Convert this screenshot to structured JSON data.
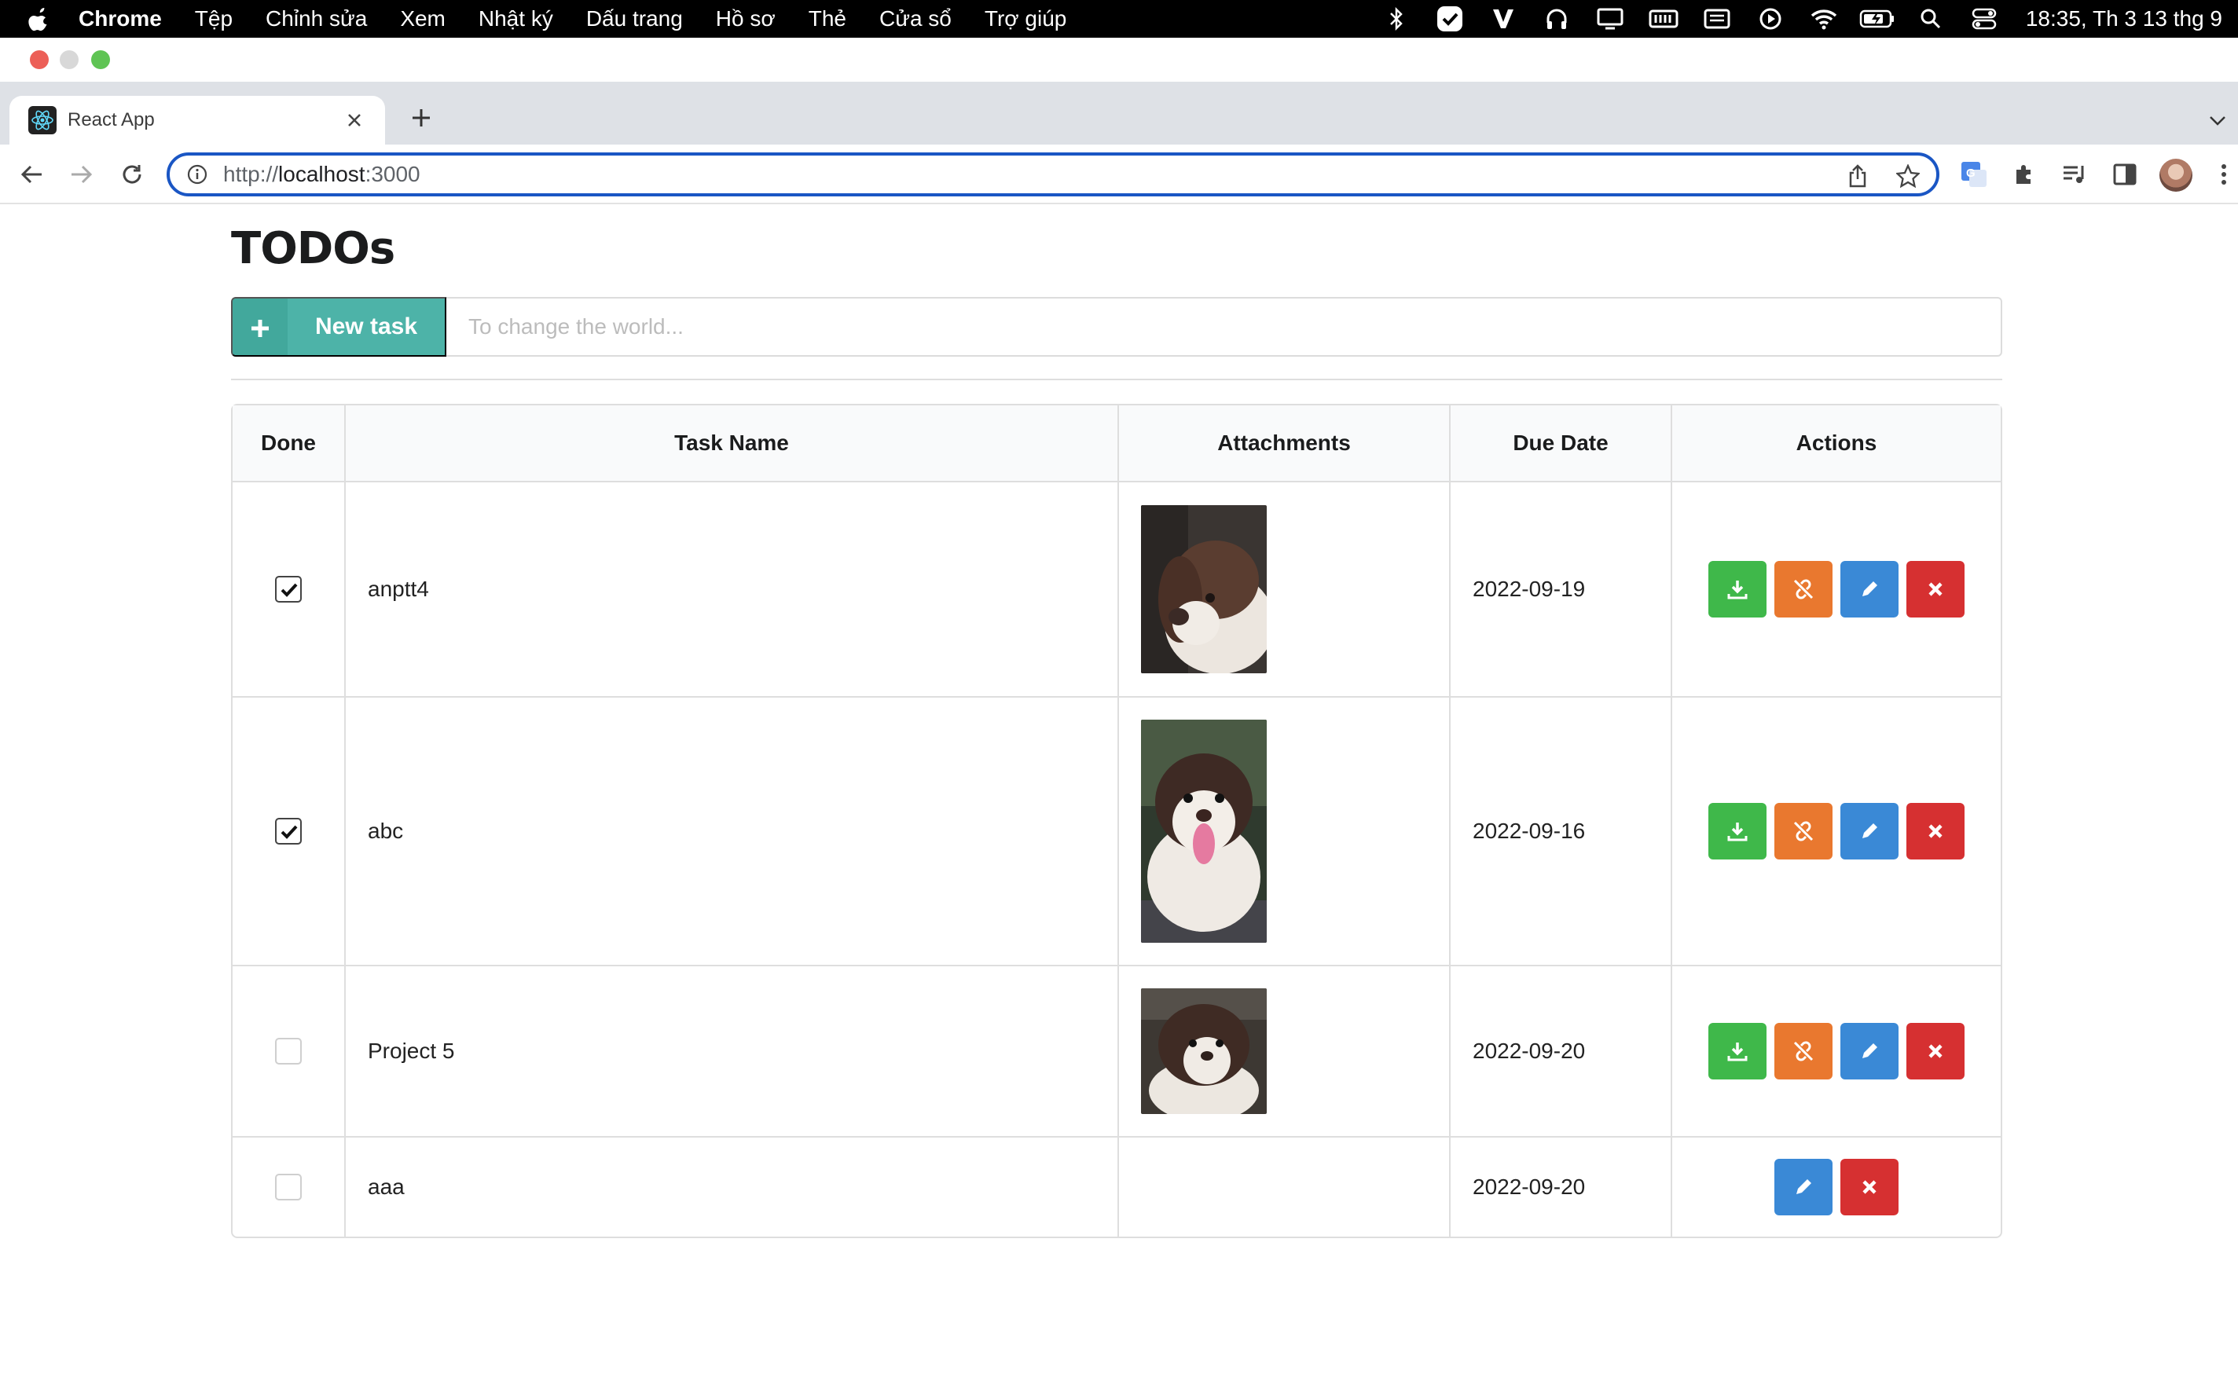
{
  "menubar": {
    "app": "Chrome",
    "items": [
      "Tệp",
      "Chỉnh sửa",
      "Xem",
      "Nhật ký",
      "Dấu trang",
      "Hồ sơ",
      "Thẻ",
      "Cửa sổ",
      "Trợ giúp"
    ],
    "clock": "18:35, Th 3 13 thg 9",
    "status_icons": [
      "bluetooth-icon",
      "checkmark-app-icon",
      "v-app-icon",
      "headphones-icon",
      "display-icon",
      "memory-icon",
      "keyboard-input-icon",
      "play-icon",
      "wifi-icon",
      "battery-icon",
      "spotlight-search-icon",
      "control-center-icon"
    ]
  },
  "browser": {
    "tab_title": "React App",
    "url_prefix": "http://",
    "url_host": "localhost",
    "url_suffix": ":3000"
  },
  "page": {
    "title": "TODOs",
    "new_task_label": "New task",
    "new_task_placeholder": "To change the world...",
    "columns": [
      "Done",
      "Task Name",
      "Attachments",
      "Due Date",
      "Actions"
    ],
    "rows": [
      {
        "done": true,
        "name": "anptt4",
        "attachment": "dog-photo-1",
        "due": "2022-09-19",
        "actions": [
          "download",
          "unlink",
          "edit",
          "delete"
        ]
      },
      {
        "done": true,
        "name": "abc",
        "attachment": "dog-photo-2",
        "due": "2022-09-16",
        "actions": [
          "download",
          "unlink",
          "edit",
          "delete"
        ]
      },
      {
        "done": false,
        "name": "Project 5",
        "attachment": "dog-photo-3",
        "due": "2022-09-20",
        "actions": [
          "download",
          "unlink",
          "edit",
          "delete"
        ]
      },
      {
        "done": false,
        "name": "aaa",
        "attachment": null,
        "due": "2022-09-20",
        "actions": [
          "edit",
          "delete"
        ]
      }
    ]
  },
  "colors": {
    "teal": "#4db3a8",
    "download": "#3fb84a",
    "unlink": "#e9782f",
    "edit": "#3a89d6",
    "delete": "#d63031"
  }
}
